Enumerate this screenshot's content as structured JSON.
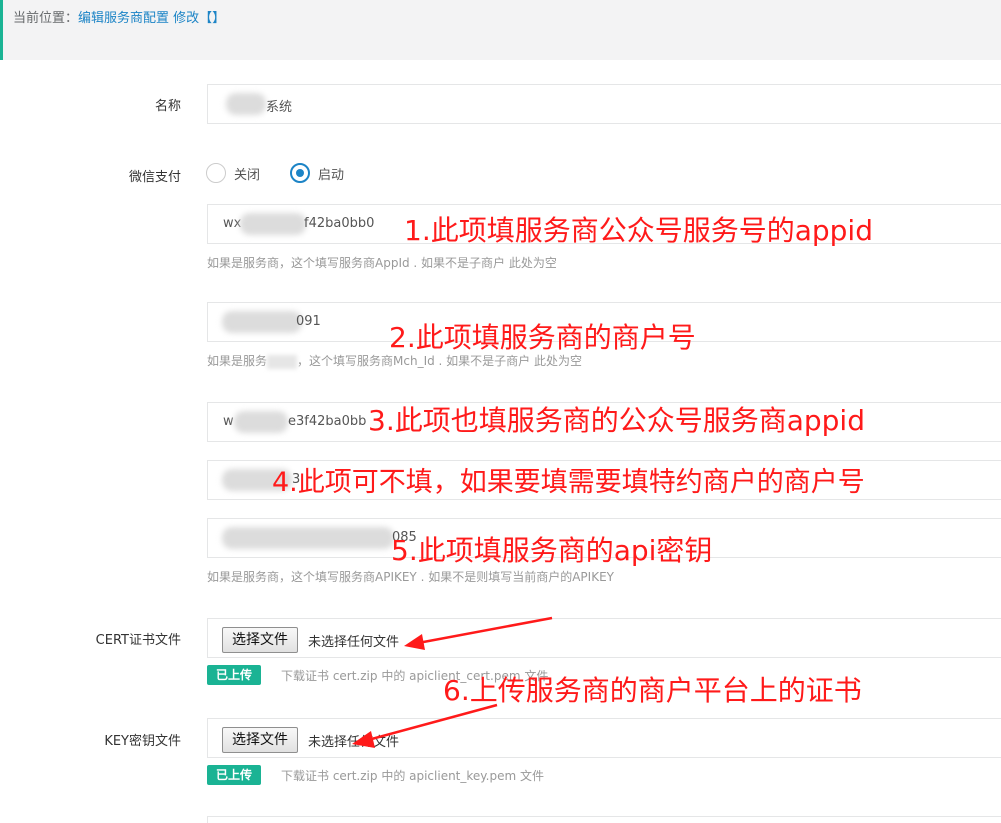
{
  "breadcrumb": {
    "prefix": "当前位置：",
    "page": "编辑服务商配置",
    "action": "修改【】"
  },
  "form": {
    "name": {
      "label": "名称",
      "value": "系统"
    },
    "wechat_pay": {
      "label": "微信支付",
      "options": [
        {
          "label": "关闭",
          "selected": false
        },
        {
          "label": "启动",
          "selected": true
        }
      ]
    },
    "appid": {
      "value_prefix": "wx",
      "value_suffix": "f42ba0bb0",
      "help": "如果是服务商，这个填写服务商AppId . 如果不是子商户 此处为空"
    },
    "mch_id": {
      "value_suffix": "091",
      "help_prefix": "如果是服务",
      "help": "，这个填写服务商Mch_Id . 如果不是子商户 此处为空"
    },
    "sub_appid": {
      "value_prefix": "w",
      "value_suffix": "e3f42ba0bb"
    },
    "sub_mch_id": {
      "value_suffix": "3"
    },
    "apikey": {
      "value_suffix": "085",
      "help": "如果是服务商，这个填写服务商APIKEY . 如果不是则填写当前商户的APIKEY"
    },
    "cert_file": {
      "label": "CERT证书文件",
      "button": "选择文件",
      "status": "未选择任何文件",
      "badge": "已上传",
      "note": "下载证书 cert.zip 中的 apiclient_cert.pem 文件"
    },
    "key_file": {
      "label": "KEY密钥文件",
      "button": "选择文件",
      "status": "未选择任何文件",
      "badge": "已上传",
      "note": "下载证书 cert.zip 中的 apiclient_key.pem 文件"
    }
  },
  "annotations": {
    "a1": "1.此项填服务商公众号服务号的appid",
    "a2": "2.此项填服务商的商户号",
    "a3": "3.此项也填服务商的公众号服务商appid",
    "a4": "4.此项可不填，如果要填需要填特约商户的商户号",
    "a5": "5.此项填服务商的api密钥",
    "a6": "6.上传服务商的商户平台上的证书"
  },
  "colors": {
    "accent": "#1c84c6",
    "success": "#1ab394",
    "annotation": "#ff1a1a"
  }
}
